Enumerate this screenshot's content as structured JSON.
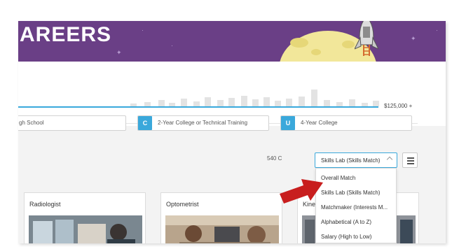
{
  "banner": {
    "title": "AREERS"
  },
  "salary": {
    "max_label": "$125,000 +"
  },
  "education_filters": [
    {
      "badge": "",
      "label": "gh School"
    },
    {
      "badge": "C",
      "label": "2-Year College or Technical Training"
    },
    {
      "badge": "U",
      "label": "4-Year College"
    }
  ],
  "results": {
    "count_label": "540 C"
  },
  "sort": {
    "selected": "Skills Lab (Skills Match)",
    "options": [
      "Overall Match",
      "Skills Lab (Skills Match)",
      "Matchmaker (Interests M...",
      "Alphabetical (A to Z)",
      "Salary (High to Low)"
    ]
  },
  "cards": [
    {
      "title": "Radiologist"
    },
    {
      "title": "Optometrist"
    },
    {
      "title": "Kine"
    }
  ],
  "colors": {
    "banner": "#6a3f86",
    "accent": "#3aa8db",
    "moon": "#f2e79a",
    "arrow": "#c81e1e"
  }
}
